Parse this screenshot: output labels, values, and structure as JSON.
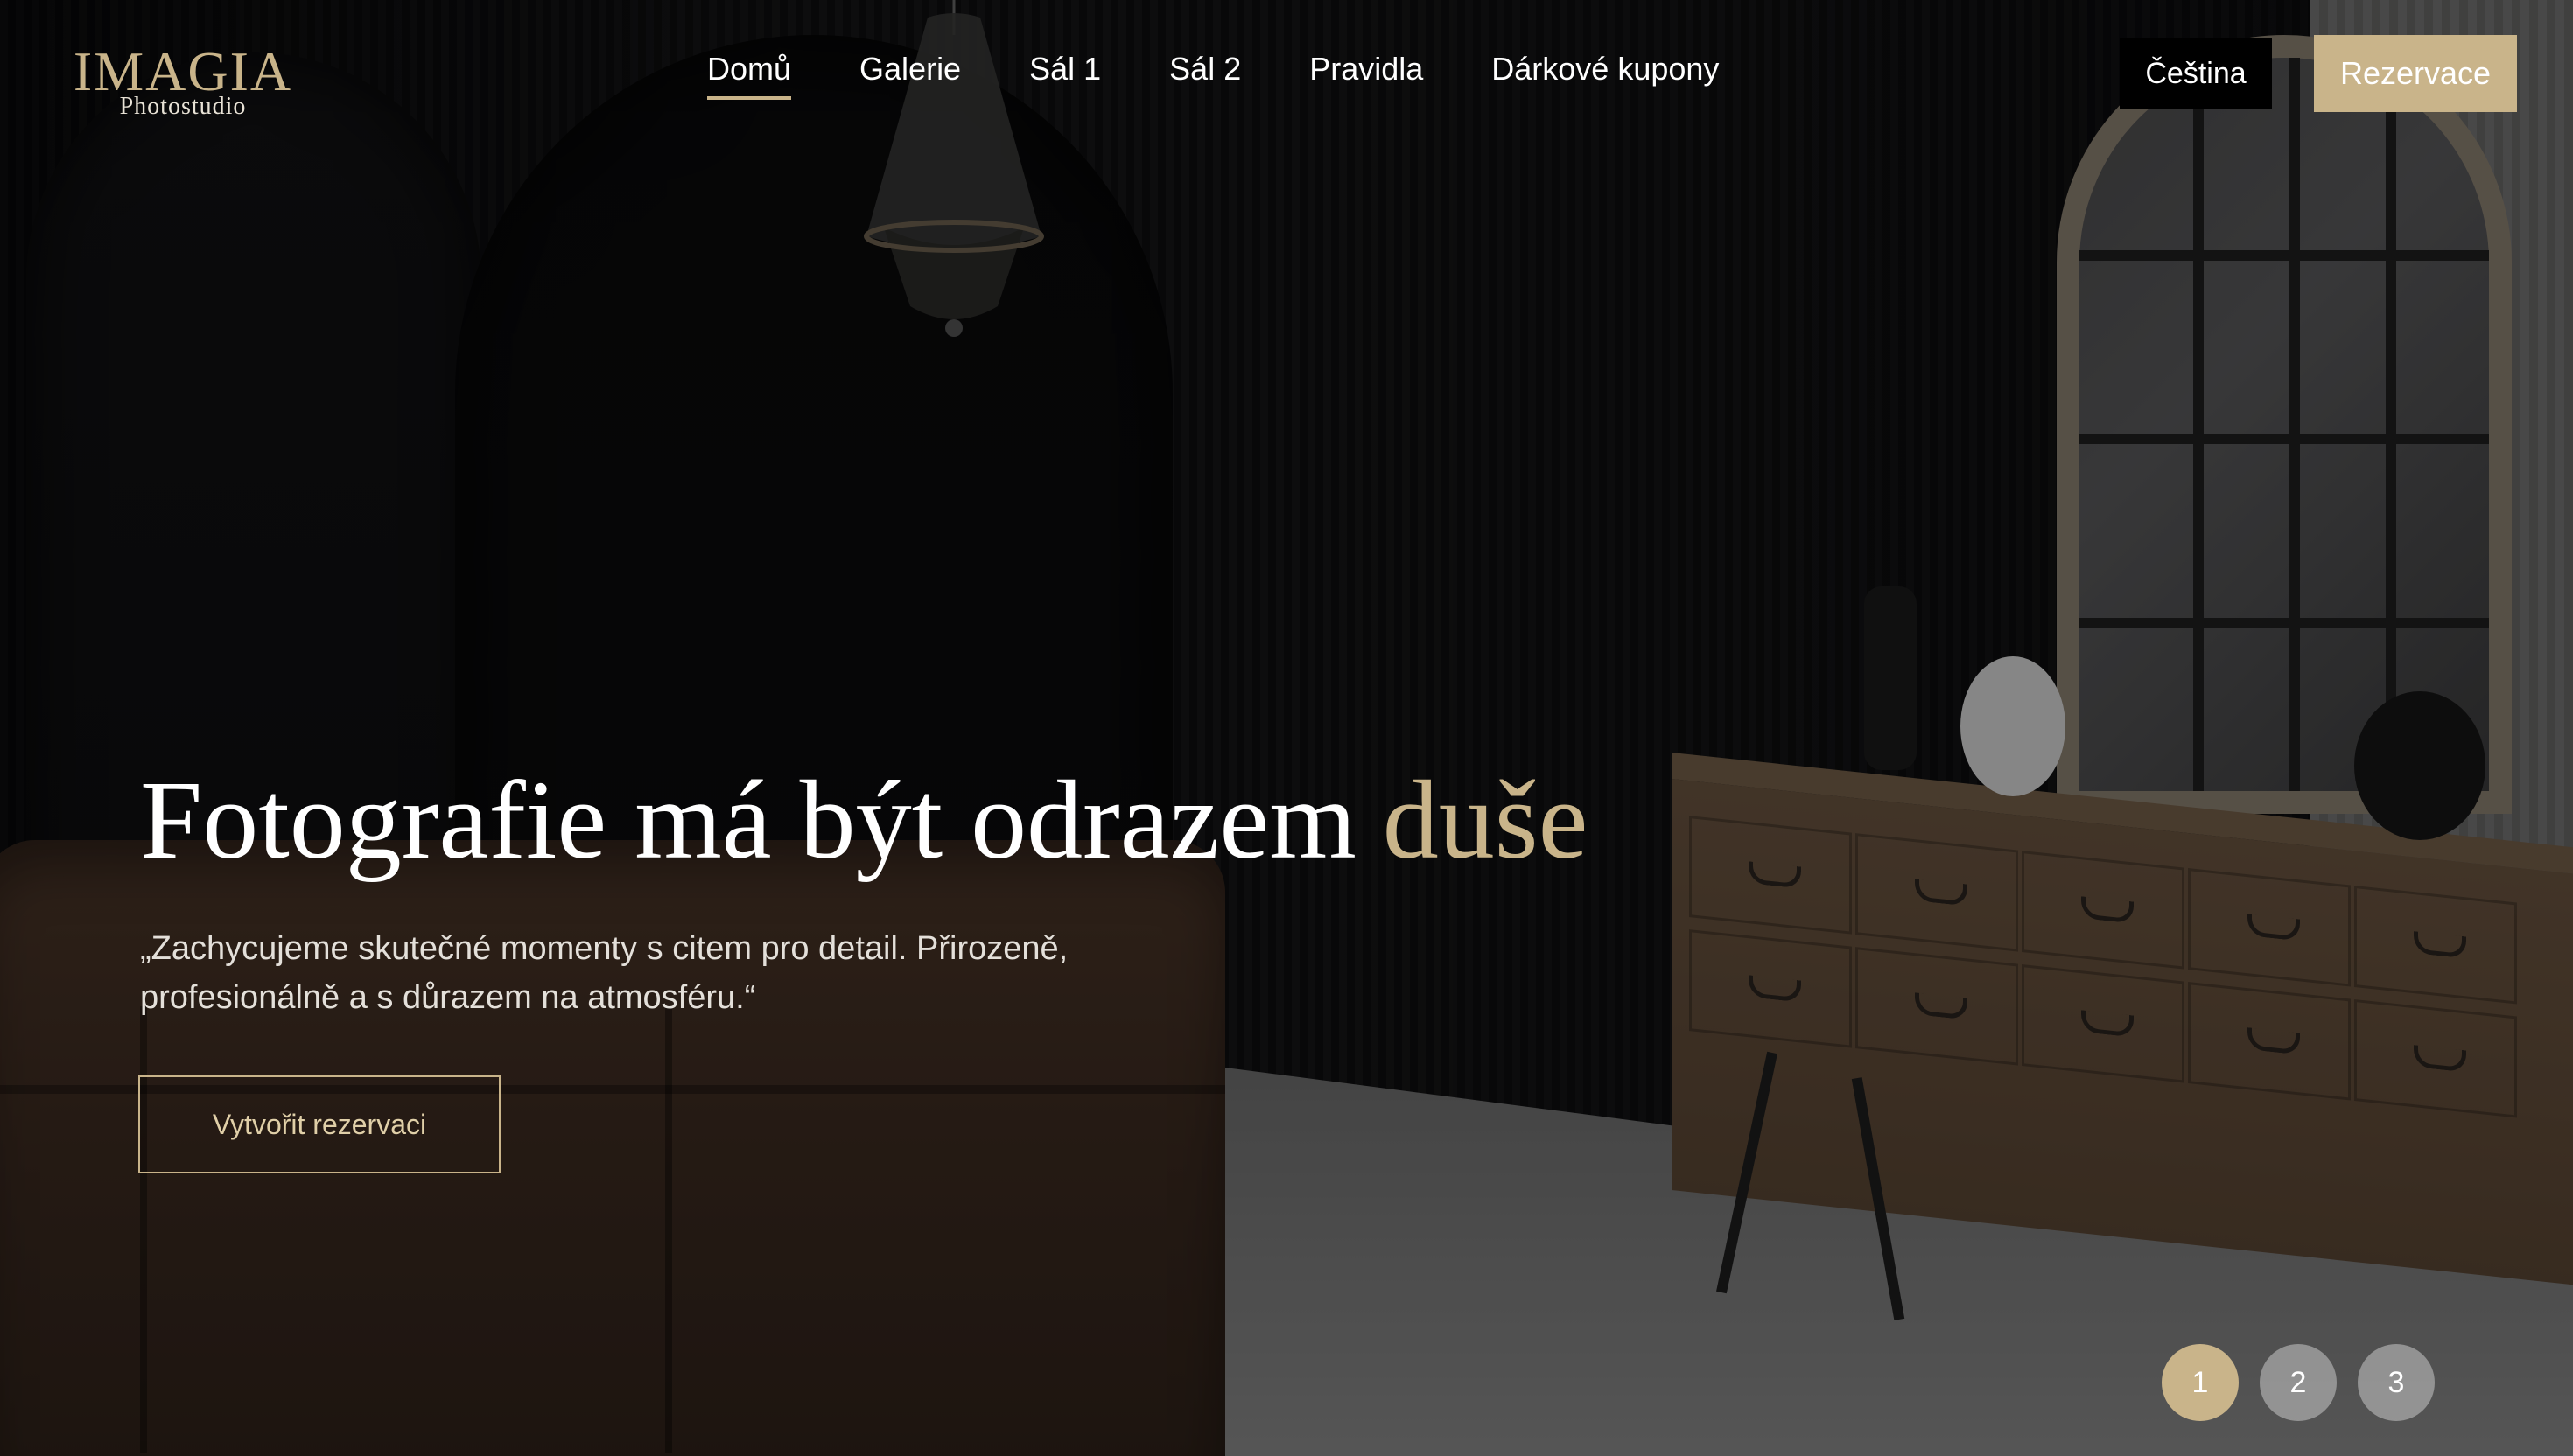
{
  "logo": {
    "main": "IMAGIA",
    "sub": "Photostudio"
  },
  "nav": {
    "items": [
      {
        "label": "Domů",
        "active": true
      },
      {
        "label": "Galerie"
      },
      {
        "label": "Sál 1"
      },
      {
        "label": "Sál 2"
      },
      {
        "label": "Pravidla"
      },
      {
        "label": "Dárkové kupony"
      }
    ]
  },
  "header": {
    "language_label": "Čeština",
    "reserve_label": "Rezervace"
  },
  "hero": {
    "title_main": "Fotografie má být odrazem",
    "title_accent": "duše",
    "quote": "„Zachycujeme skutečné momenty s citem pro detail. Přirozeně, profesionálně a s důrazem na atmosféru.“",
    "cta_label": "Vytvořit rezervaci"
  },
  "pager": {
    "pages": [
      "1",
      "2",
      "3"
    ],
    "active_index": 0
  },
  "colors": {
    "accent": "#c9b48a",
    "background": "#0d0d0e"
  }
}
